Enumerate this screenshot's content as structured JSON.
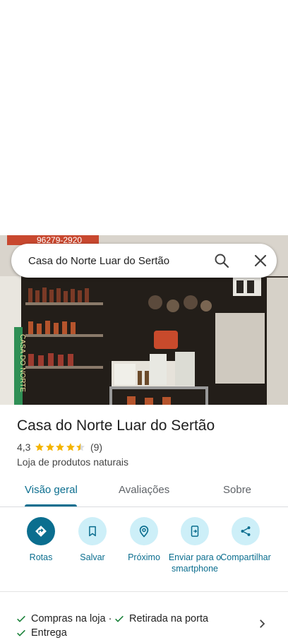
{
  "search": {
    "query": "Casa do Norte Luar do Sertão"
  },
  "photo": {
    "phone_text": "96279-2920",
    "sign_text": "CASA DO NORTE"
  },
  "place": {
    "name": "Casa do Norte Luar do Sertão",
    "rating": "4,3",
    "stars": 4.3,
    "review_count": "(9)",
    "category": "Loja de produtos naturais"
  },
  "tabs": [
    {
      "label": "Visão geral",
      "active": true
    },
    {
      "label": "Avaliações",
      "active": false
    },
    {
      "label": "Sobre",
      "active": false
    }
  ],
  "actions": [
    {
      "label": "Rotas",
      "icon": "directions-icon"
    },
    {
      "label": "Salvar",
      "icon": "bookmark-icon"
    },
    {
      "label": "Próximo",
      "icon": "nearby-icon"
    },
    {
      "label": "Enviar para o smartphone",
      "icon": "send-to-phone-icon"
    },
    {
      "label": "Compartilhar",
      "icon": "share-icon"
    }
  ],
  "amenities": [
    {
      "label": "Compras na loja ·"
    },
    {
      "label": "Retirada na porta"
    },
    {
      "label": "Entrega"
    }
  ],
  "colors": {
    "accent": "#0b6e8f",
    "action_bg": "#cdeff8",
    "star": "#f4b400",
    "check": "#188038"
  }
}
